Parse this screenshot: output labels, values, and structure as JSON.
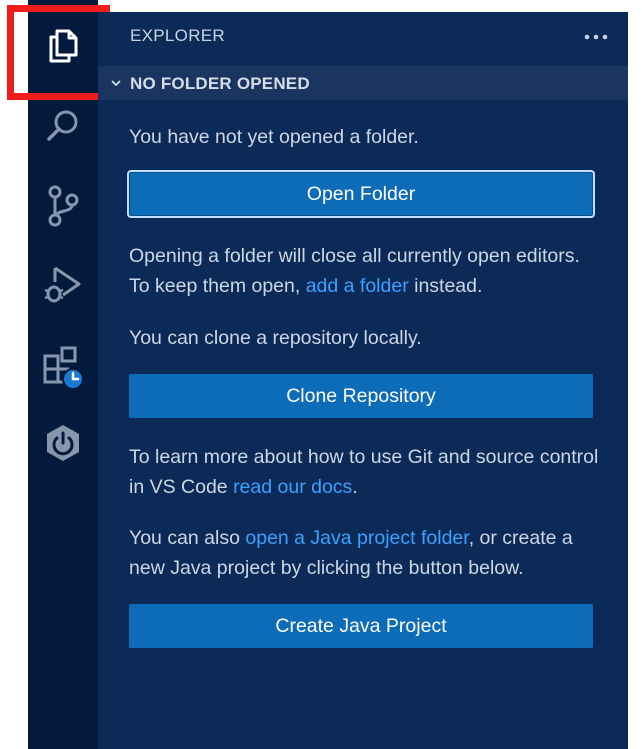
{
  "activity_bar": {
    "items": [
      {
        "icon": "files-icon"
      },
      {
        "icon": "search-icon"
      },
      {
        "icon": "source-control-icon"
      },
      {
        "icon": "run-debug-icon"
      },
      {
        "icon": "extensions-icon"
      },
      {
        "icon": "spring-boot-icon"
      }
    ]
  },
  "sidebar": {
    "title": "EXPLORER",
    "section_title": "NO FOLDER OPENED",
    "msg_not_opened": "You have not yet opened a folder.",
    "open_folder_label": "Open Folder",
    "warning_prefix": "Opening a folder will close all currently open editors. To keep them open, ",
    "warning_link": "add a folder",
    "warning_suffix": " instead.",
    "clone_msg": "You can clone a repository locally.",
    "clone_label": "Clone Repository",
    "learn_prefix": "To learn more about how to use Git and source control in VS Code ",
    "learn_link": "read our docs",
    "learn_suffix": ".",
    "java_prefix": "You can also ",
    "java_link": "open a Java project folder",
    "java_suffix": ", or create a new Java project by clicking the button below.",
    "create_java_label": "Create Java Project"
  },
  "colors": {
    "activity_bar_bg": "#031a3d",
    "sidebar_bg": "#0b2a57",
    "button_bg": "#0d6cb8",
    "link": "#3aa1ff",
    "highlight": "#ef1c1c"
  }
}
